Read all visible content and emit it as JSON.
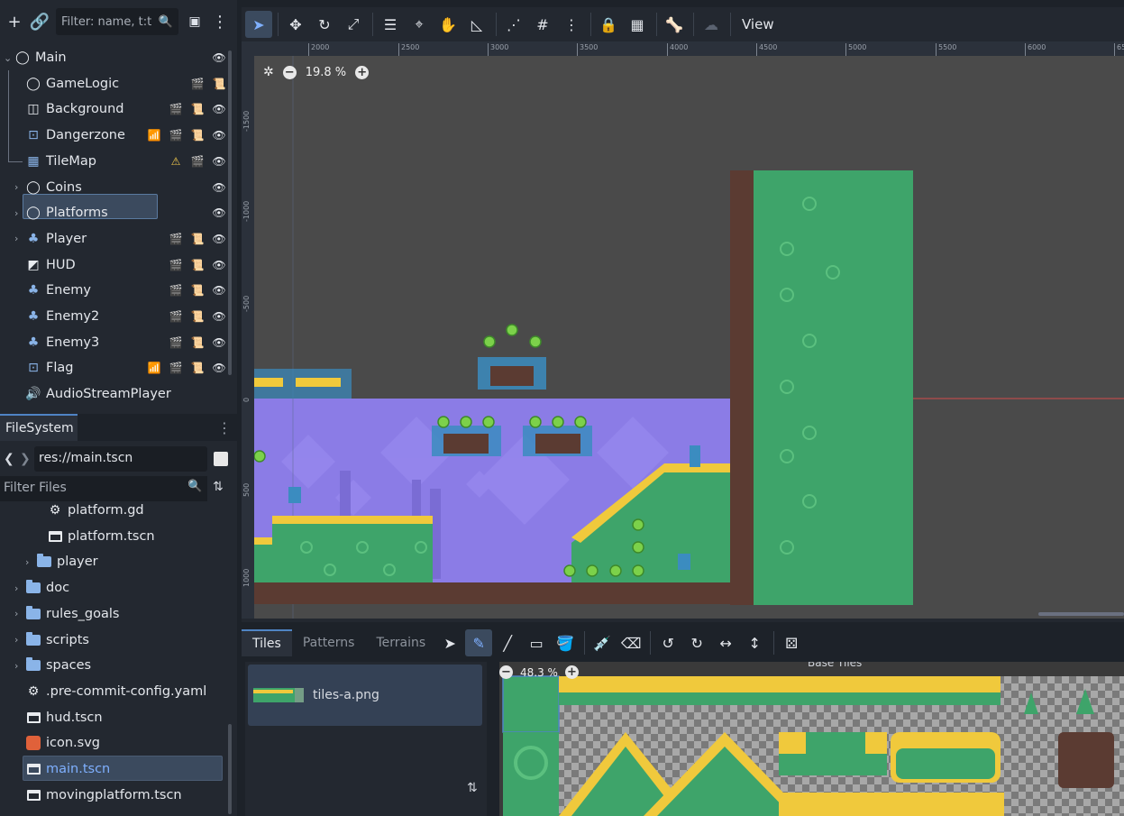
{
  "scene_dock": {
    "filter_placeholder": "Filter: name, t:t",
    "nodes": [
      {
        "label": "Main",
        "icon": "node-icon",
        "expand": "open",
        "tags": [
          "eye"
        ]
      },
      {
        "label": "GameLogic",
        "icon": "node-icon",
        "tags": [
          "scene",
          "script"
        ]
      },
      {
        "label": "Background",
        "icon": "parallax-icon",
        "tags": [
          "scene",
          "script",
          "eye"
        ]
      },
      {
        "label": "Dangerzone",
        "icon": "area-icon",
        "tags": [
          "signal",
          "scene",
          "script",
          "eye"
        ]
      },
      {
        "label": "TileMap",
        "icon": "tilemap-icon",
        "tags": [
          "warning",
          "scene",
          "eye"
        ],
        "selected": true
      },
      {
        "label": "Coins",
        "icon": "node-icon",
        "expand": "closed",
        "tags": [
          "eye"
        ]
      },
      {
        "label": "Platforms",
        "icon": "node-icon",
        "expand": "closed",
        "tags": [
          "eye"
        ]
      },
      {
        "label": "Player",
        "icon": "character-icon",
        "expand": "closed",
        "tags": [
          "scene",
          "script",
          "eye"
        ]
      },
      {
        "label": "HUD",
        "icon": "canvas-layer-icon",
        "tags": [
          "scene",
          "script",
          "eye"
        ]
      },
      {
        "label": "Enemy",
        "icon": "character-icon",
        "tags": [
          "scene",
          "script-white",
          "eye"
        ]
      },
      {
        "label": "Enemy2",
        "icon": "character-icon",
        "tags": [
          "scene",
          "script-white",
          "eye"
        ]
      },
      {
        "label": "Enemy3",
        "icon": "character-icon",
        "tags": [
          "scene",
          "script-white",
          "eye"
        ]
      },
      {
        "label": "Flag",
        "icon": "area-icon",
        "tags": [
          "signal",
          "scene",
          "script",
          "eye"
        ]
      },
      {
        "label": "AudioStreamPlayer",
        "icon": "speaker-icon",
        "tags": []
      }
    ]
  },
  "filesystem": {
    "tab": "FileSystem",
    "path": "res://main.tscn",
    "filter_placeholder": "Filter Files",
    "items": [
      {
        "label": "platform.gd",
        "type": "gear",
        "indent": 2
      },
      {
        "label": "platform.tscn",
        "type": "scene",
        "indent": 2
      },
      {
        "label": "player",
        "type": "folder",
        "indent": 1,
        "expand": "closed"
      },
      {
        "label": "doc",
        "type": "folder",
        "indent": 0,
        "expand": "closed"
      },
      {
        "label": "rules_goals",
        "type": "folder",
        "indent": 0,
        "expand": "closed"
      },
      {
        "label": "scripts",
        "type": "folder",
        "indent": 0,
        "expand": "closed"
      },
      {
        "label": "spaces",
        "type": "folder",
        "indent": 0,
        "expand": "closed"
      },
      {
        "label": ".pre-commit-config.yaml",
        "type": "gear",
        "indent": 0
      },
      {
        "label": "hud.tscn",
        "type": "scene",
        "indent": 0
      },
      {
        "label": "icon.svg",
        "type": "image",
        "indent": 0
      },
      {
        "label": "main.tscn",
        "type": "scene",
        "indent": 0,
        "selected": true
      },
      {
        "label": "movingplatform.tscn",
        "type": "scene",
        "indent": 0
      }
    ]
  },
  "toolbar": {
    "view_label": "View"
  },
  "viewport": {
    "zoom": "19.8 %",
    "ruler_x": [
      "2000",
      "2500",
      "3000",
      "3500",
      "4000",
      "4500",
      "5000",
      "5500",
      "6000",
      "65"
    ],
    "ruler_y": [
      "-1500",
      "-1000",
      "-500",
      "0",
      "500",
      "1000"
    ]
  },
  "tile_panel": {
    "tabs": [
      "Tiles",
      "Patterns",
      "Terrains"
    ],
    "active_tab": "Tiles",
    "source": "tiles-a.png",
    "atlas_zoom": "48.3 %",
    "atlas_title": "Base Tiles"
  },
  "colors": {
    "accent": "#4f84c4",
    "selection": "#3b4a5e",
    "background_purple": "#8b7ce6",
    "ground_green": "#3ea46a",
    "ground_yellow": "#f0c93c",
    "dirt": "#5b3b32"
  }
}
